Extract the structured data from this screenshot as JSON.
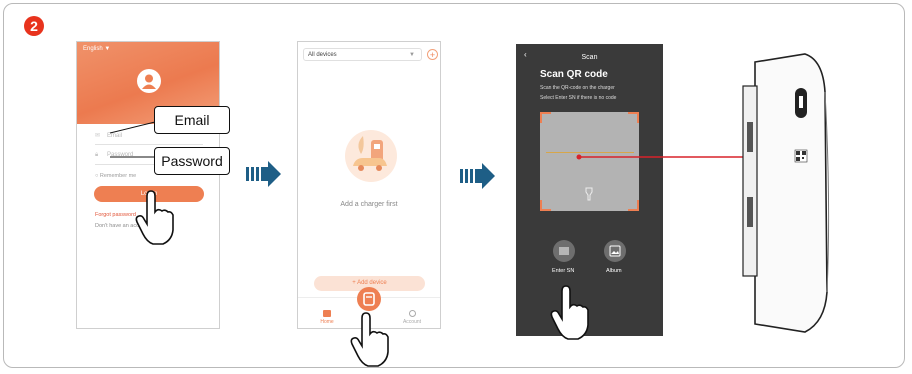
{
  "step_number": "2",
  "colors": {
    "accent": "#ee7f52",
    "arrow_blue": "#1e5e86",
    "badge_red": "#e8331d",
    "scan_line_red": "#d8222a"
  },
  "login_screen": {
    "language": "English ▼",
    "email_placeholder": "Email",
    "password_placeholder": "Password",
    "remember": "Remember me",
    "login_button": "Log in",
    "forgot": "Forgot password",
    "no_account": "Don't have an account"
  },
  "callouts": {
    "email": "Email",
    "password": "Password"
  },
  "devices_screen": {
    "filter": "All devices",
    "empty": "Add a charger first",
    "add_button": "+ Add device",
    "tabs": {
      "home": "Home",
      "account": "Account"
    }
  },
  "scan_screen": {
    "title": "Scan",
    "heading": "Scan QR code",
    "hint1": "Scan the QR-code on the charger",
    "hint2": "Select Enter SN if there is no code",
    "enter_sn": "Enter SN",
    "album": "Album"
  },
  "icons": [
    "person-icon",
    "mail-icon",
    "lock-icon",
    "radio-icon",
    "chevron-down-icon",
    "plus-icon",
    "charger-car-illustration",
    "home-icon",
    "charger-icon",
    "account-icon",
    "back-icon",
    "flashlight-icon",
    "barcode-icon",
    "image-icon",
    "hand-pointer-icon",
    "arrow-right-icon",
    "qr-code-icon"
  ]
}
